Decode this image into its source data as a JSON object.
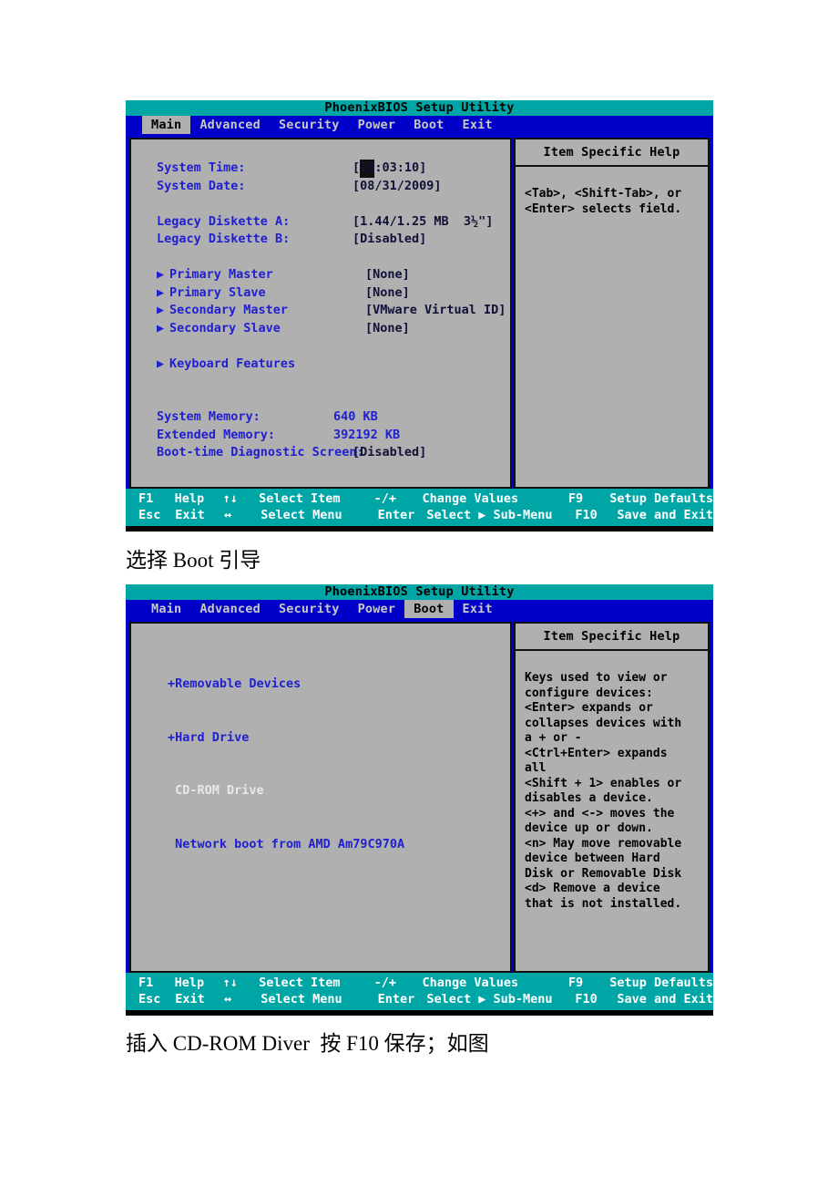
{
  "document": {
    "caption_1": "选择 Boot 引导",
    "caption_2": "插入 CD-ROM Diver  按 F10 保存；如图"
  },
  "colors": {
    "title_bar": "#00a6a6",
    "menu_bar": "#0000c8",
    "panel": "#b0b0b0",
    "label_blue": "#2020d0",
    "fn_bar": "#00a6a6"
  },
  "screen_main": {
    "title": "PhoenixBIOS Setup Utility",
    "menu": [
      {
        "label": "Main",
        "active": true
      },
      {
        "label": "Advanced",
        "active": false
      },
      {
        "label": "Security",
        "active": false
      },
      {
        "label": "Power",
        "active": false
      },
      {
        "label": "Boot",
        "active": false
      },
      {
        "label": "Exit",
        "active": false
      }
    ],
    "fields": {
      "system_time_label": "System Time:",
      "system_time_open": "[",
      "system_time_cursor": "15",
      "system_time_rest": ":03:10]",
      "system_date_label": "System Date:",
      "system_date_value": "[08/31/2009]",
      "diskette_a_label": "Legacy Diskette A:",
      "diskette_a_value": "[1.44/1.25 MB  3½\"]",
      "diskette_b_label": "Legacy Diskette B:",
      "diskette_b_value": "[Disabled]",
      "primary_master_label": "Primary Master",
      "primary_master_value": "[None]",
      "primary_slave_label": "Primary Slave",
      "primary_slave_value": "[None]",
      "secondary_master_label": "Secondary Master",
      "secondary_master_value": "[VMware Virtual ID]",
      "secondary_slave_label": "Secondary Slave",
      "secondary_slave_value": "[None]",
      "keyboard_features_label": "Keyboard Features",
      "system_memory_label": "System Memory:",
      "system_memory_value": "640 KB",
      "extended_memory_label": "Extended Memory:",
      "extended_memory_value": "392192 KB",
      "boot_diag_label": "Boot-time Diagnostic Screen:",
      "boot_diag_value": "[Disabled]",
      "submenu_arrow": "▶"
    },
    "help": {
      "title": "Item Specific Help",
      "text": "<Tab>, <Shift-Tab>, or\n<Enter> selects field."
    }
  },
  "screen_boot": {
    "title": "PhoenixBIOS Setup Utility",
    "menu": [
      {
        "label": "Main",
        "active": false
      },
      {
        "label": "Advanced",
        "active": false
      },
      {
        "label": "Security",
        "active": false
      },
      {
        "label": "Power",
        "active": false
      },
      {
        "label": "Boot",
        "active": true
      },
      {
        "label": "Exit",
        "active": false
      }
    ],
    "devices": [
      {
        "label": "+Removable Devices",
        "selected": false
      },
      {
        "label": "+Hard Drive",
        "selected": false
      },
      {
        "label": " CD-ROM Drive",
        "selected": true
      },
      {
        "label": " Network boot from AMD Am79C970A",
        "selected": false
      }
    ],
    "help": {
      "title": "Item Specific Help",
      "text": "Keys used to view or\nconfigure devices:\n<Enter> expands or\ncollapses devices with\na + or -\n<Ctrl+Enter> expands\nall\n<Shift + 1> enables or\ndisables a device.\n<+> and <-> moves the\ndevice up or down.\n<n> May move removable\ndevice between Hard\nDisk or Removable Disk\n<d> Remove a device\nthat is not installed."
    }
  },
  "fnbar": {
    "row1": {
      "key": "F1",
      "action": "Help",
      "symbol": "↑↓",
      "desc": "Select Item",
      "symbol2": "-/+",
      "desc2": "Change Values",
      "key2": "F9",
      "action2": "Setup Defaults"
    },
    "row2": {
      "key": "Esc",
      "action": "Exit",
      "symbol": "↔",
      "desc": "Select Menu",
      "symbol2": "Enter",
      "desc2": "Select ▶ Sub-Menu",
      "key2": "F10",
      "action2": "Save and Exit"
    }
  }
}
